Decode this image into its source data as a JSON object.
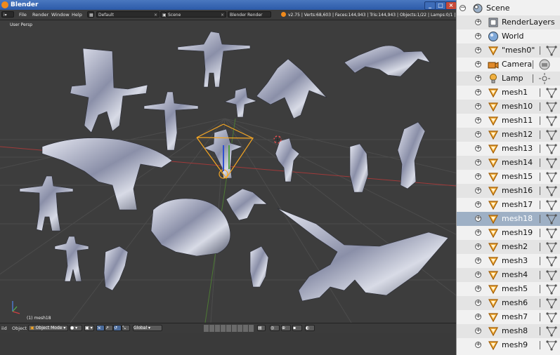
{
  "window": {
    "title": "Blender",
    "min_symbol": "_",
    "max_symbol": "□",
    "close_symbol": "×"
  },
  "header": {
    "menus": [
      "File",
      "Render",
      "Window",
      "Help"
    ],
    "layout_value": "Default",
    "scene_value": "Scene",
    "engine_value": "Blender Render",
    "stats": "v2.75 | Verts:68,603 | Faces:144,943 | Tris:144,943 | Objects:1/22 | Lamps:0/1 | Mem:106.35M (0."
  },
  "viewport": {
    "view_label": "User Persp",
    "object_label": "(1) mesh18"
  },
  "footer": {
    "view_menu": "iid",
    "object_menu": "Object",
    "mode_value": "Object Mode",
    "pivot_value": "Global"
  },
  "outliner": {
    "rows": [
      {
        "label": "Scene",
        "kind": "scene",
        "depth": 0
      },
      {
        "label": "RenderLayers",
        "kind": "renderlayers",
        "depth": 1
      },
      {
        "label": "World",
        "kind": "world",
        "depth": 1
      },
      {
        "label": "\"mesh0\"",
        "kind": "mesh",
        "depth": 1
      },
      {
        "label": "Camera",
        "kind": "camera",
        "depth": 1
      },
      {
        "label": "Lamp",
        "kind": "lamp",
        "depth": 1
      },
      {
        "label": "mesh1",
        "kind": "mesh",
        "depth": 1
      },
      {
        "label": "mesh10",
        "kind": "mesh",
        "depth": 1
      },
      {
        "label": "mesh11",
        "kind": "mesh",
        "depth": 1
      },
      {
        "label": "mesh12",
        "kind": "mesh",
        "depth": 1
      },
      {
        "label": "mesh13",
        "kind": "mesh",
        "depth": 1
      },
      {
        "label": "mesh14",
        "kind": "mesh",
        "depth": 1
      },
      {
        "label": "mesh15",
        "kind": "mesh",
        "depth": 1
      },
      {
        "label": "mesh16",
        "kind": "mesh",
        "depth": 1
      },
      {
        "label": "mesh17",
        "kind": "mesh",
        "depth": 1
      },
      {
        "label": "mesh18",
        "kind": "mesh",
        "depth": 1,
        "selected": true
      },
      {
        "label": "mesh19",
        "kind": "mesh",
        "depth": 1
      },
      {
        "label": "mesh2",
        "kind": "mesh",
        "depth": 1
      },
      {
        "label": "mesh3",
        "kind": "mesh",
        "depth": 1
      },
      {
        "label": "mesh4",
        "kind": "mesh",
        "depth": 1
      },
      {
        "label": "mesh5",
        "kind": "mesh",
        "depth": 1
      },
      {
        "label": "mesh6",
        "kind": "mesh",
        "depth": 1
      },
      {
        "label": "mesh7",
        "kind": "mesh",
        "depth": 1
      },
      {
        "label": "mesh8",
        "kind": "mesh",
        "depth": 1
      },
      {
        "label": "mesh9",
        "kind": "mesh",
        "depth": 1
      }
    ]
  },
  "colors": {
    "selection_orange": "#f5a623",
    "mesh_icon_orange": "#e07a10",
    "axis_red": "#c84040",
    "axis_green": "#5a9a3a"
  }
}
